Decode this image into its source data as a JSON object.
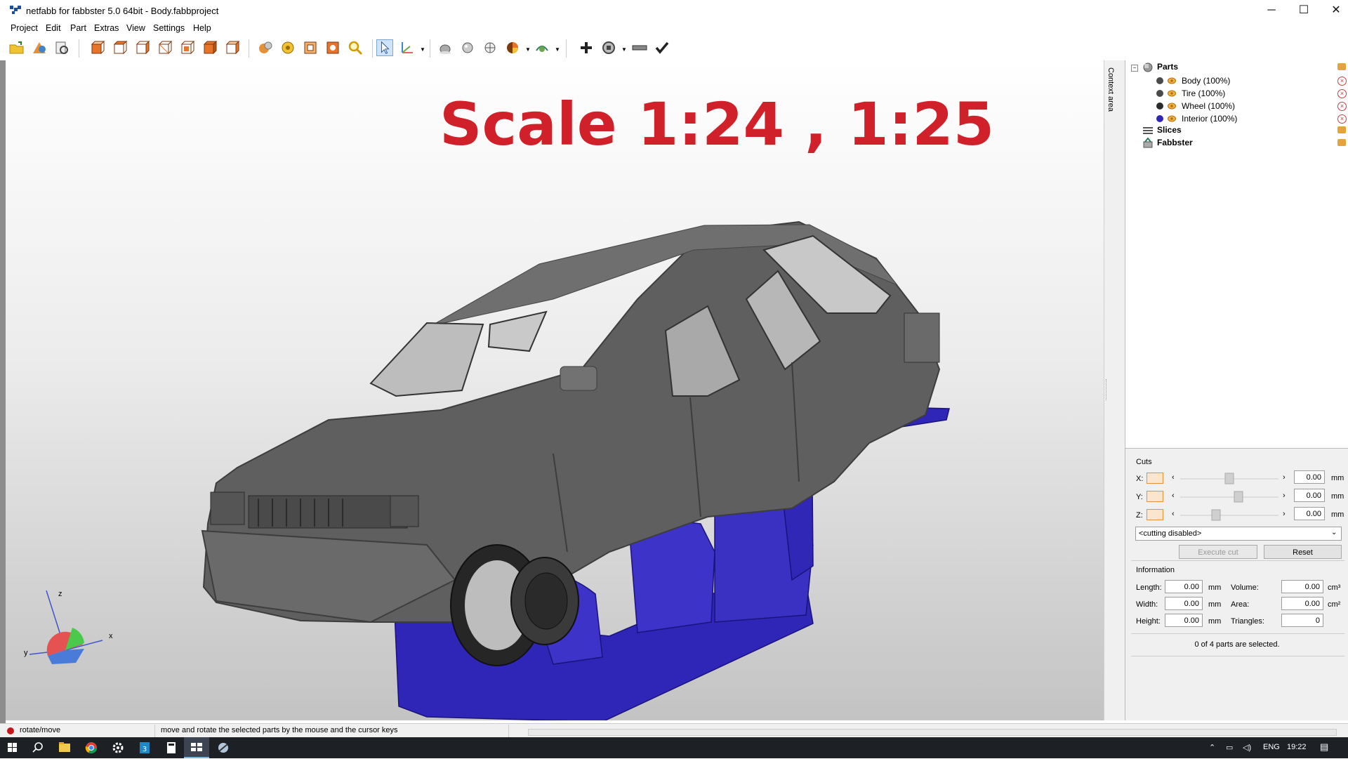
{
  "window": {
    "title": "netfabb for fabbster 5.0 64bit - Body.fabbproject",
    "minimize": "─",
    "maximize": "☐",
    "close": "✕"
  },
  "menu": [
    "Project",
    "Edit",
    "Part",
    "Extras",
    "View",
    "Settings",
    "Help"
  ],
  "toolbar": {
    "icons": [
      "open-icon",
      "add-part-icon",
      "load-icon",
      "view-front-icon",
      "view-back-icon",
      "view-left-icon",
      "view-right-icon",
      "view-top-icon",
      "view-bottom-icon",
      "view-iso-icon",
      "rotate-view-icon",
      "pan-view-icon",
      "zoom-fit-icon",
      "zoom-selection-icon",
      "magnifier-icon",
      "select-pointer-icon",
      "axes-icon",
      "shading-icon",
      "smooth-shading-icon",
      "mesh-icon",
      "color-wheel-icon",
      "lighting-icon",
      "add-icon",
      "repair-icon",
      "ruler-icon",
      "checkmark-icon"
    ]
  },
  "viewport": {
    "overlay_text": "Scale 1:24 , 1:25",
    "axis": {
      "z": "z",
      "x": "x",
      "y": "y"
    },
    "colors": {
      "body": "#5f5f5f",
      "interior": "#2f26b8",
      "tire": "#2a2a2a"
    }
  },
  "dock": {
    "context_label": "Context area"
  },
  "tree": {
    "root": "Parts",
    "parts": [
      {
        "name": "Body (100%)",
        "color": "#4a4a4a"
      },
      {
        "name": "Tire (100%)",
        "color": "#4a4a4a"
      },
      {
        "name": "Wheel (100%)",
        "color": "#2a2a2a"
      },
      {
        "name": "Interior (100%)",
        "color": "#2f26b8"
      }
    ],
    "slices": "Slices",
    "fabbster": "Fabbster"
  },
  "cuts": {
    "title": "Cuts",
    "x_label": "X:",
    "y_label": "Y:",
    "z_label": "Z:",
    "x_value": "0.00",
    "y_value": "0.00",
    "z_value": "0.00",
    "x_position": 0.5,
    "y_position": 0.6,
    "z_position": 0.35,
    "unit": "mm",
    "mode": "<cutting disabled>",
    "execute": "Execute cut",
    "reset": "Reset"
  },
  "info": {
    "title": "Information",
    "length_label": "Length:",
    "width_label": "Width:",
    "height_label": "Height:",
    "volume_label": "Volume:",
    "area_label": "Area:",
    "triangles_label": "Triangles:",
    "length": "0.00",
    "width": "0.00",
    "height": "0.00",
    "volume": "0.00",
    "area": "0.00",
    "triangles": "0",
    "unit_mm": "mm",
    "unit_cm3": "cm³",
    "unit_cm2": "cm²",
    "selection": "0 of 4 parts are selected."
  },
  "status": {
    "mode": "rotate/move",
    "hint": "move and rotate the selected parts by the mouse and the cursor keys"
  },
  "taskbar": {
    "lang": "ENG",
    "time": "19:22"
  }
}
